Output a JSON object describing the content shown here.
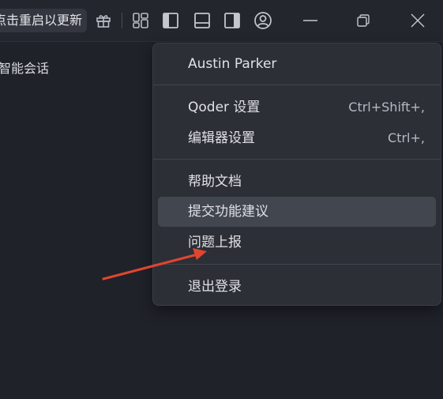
{
  "titlebar": {
    "update_button_label": "点击重启以更新"
  },
  "sidebar": {
    "chat_label": "智能会话"
  },
  "account_menu": {
    "user_name": "Austin Parker",
    "items": [
      {
        "label": "Qoder 设置",
        "shortcut": "Ctrl+Shift+,"
      },
      {
        "label": "编辑器设置",
        "shortcut": "Ctrl+,"
      },
      {
        "label": "帮助文档",
        "shortcut": ""
      },
      {
        "label": "提交功能建议",
        "shortcut": ""
      },
      {
        "label": "问题上报",
        "shortcut": ""
      },
      {
        "label": "退出登录",
        "shortcut": ""
      }
    ],
    "highlighted_item": "提交功能建议"
  },
  "colors": {
    "background": "#1f2229",
    "titlebar": "#23262d",
    "menu_background": "#2c2f36",
    "menu_hover": "#42464f",
    "annotation_arrow": "#e0452f"
  },
  "icons": [
    "gift-icon",
    "layout-icon",
    "toggle-left-panel-icon",
    "toggle-bottom-panel-icon",
    "toggle-right-panel-icon",
    "account-icon",
    "minimize-icon",
    "restore-icon",
    "close-icon"
  ]
}
